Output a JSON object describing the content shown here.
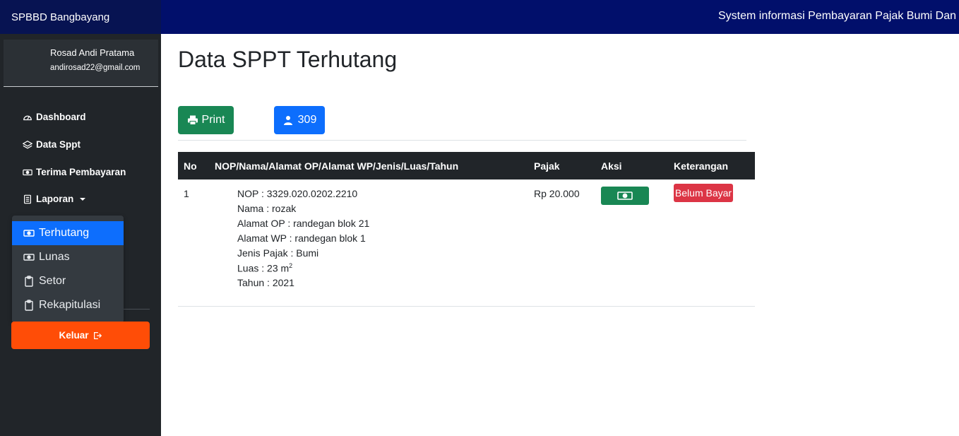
{
  "app": {
    "brand": "SPBBD Bangbayang",
    "marquee": "System informasi Pembayaran Pajak Bumi Dan"
  },
  "user": {
    "name": "Rosad Andi Pratama",
    "email": "andirosad22@gmail.com"
  },
  "sidebar": {
    "items": [
      {
        "label": "Dashboard",
        "icon": "speedometer-icon"
      },
      {
        "label": "Data Sppt",
        "icon": "layers-icon"
      },
      {
        "label": "Terima Pembayaran",
        "icon": "cash-icon"
      },
      {
        "label": "Laporan",
        "icon": "document-icon"
      }
    ],
    "dropdown": [
      {
        "label": "Terhutang",
        "icon": "cash-icon",
        "active": true
      },
      {
        "label": "Lunas",
        "icon": "cash-icon",
        "active": false
      },
      {
        "label": "Setor",
        "icon": "clipboard-icon",
        "active": false
      },
      {
        "label": "Rekapitulasi",
        "icon": "clipboard-icon",
        "active": false
      }
    ],
    "logout_label": "Keluar"
  },
  "main": {
    "title": "Data SPPT Terhutang",
    "print_label": "Print",
    "count_label": "309",
    "table": {
      "headers": [
        "No",
        "NOP/Nama/Alamat OP/Alamat WP/Jenis/Luas/Tahun",
        "Pajak",
        "Aksi",
        "Keterangan"
      ],
      "rows": [
        {
          "no": "1",
          "details": [
            "NOP : 3329.020.0202.2210",
            "Nama : rozak",
            "Alamat OP : randegan blok 21",
            "Alamat WP : randegan blok 1",
            "Jenis Pajak : Bumi",
            "Luas : 23 m",
            "Tahun : 2021"
          ],
          "luas_sup": "2",
          "pajak": "Rp 20.000",
          "status": "Belum Bayar"
        }
      ]
    }
  },
  "colors": {
    "brand_bg": "#071352",
    "topbar_bg": "#010f6b",
    "sidebar_bg": "#212529",
    "success": "#198754",
    "primary": "#0d6efd",
    "danger": "#dc3545",
    "logout": "#ff4d07"
  }
}
